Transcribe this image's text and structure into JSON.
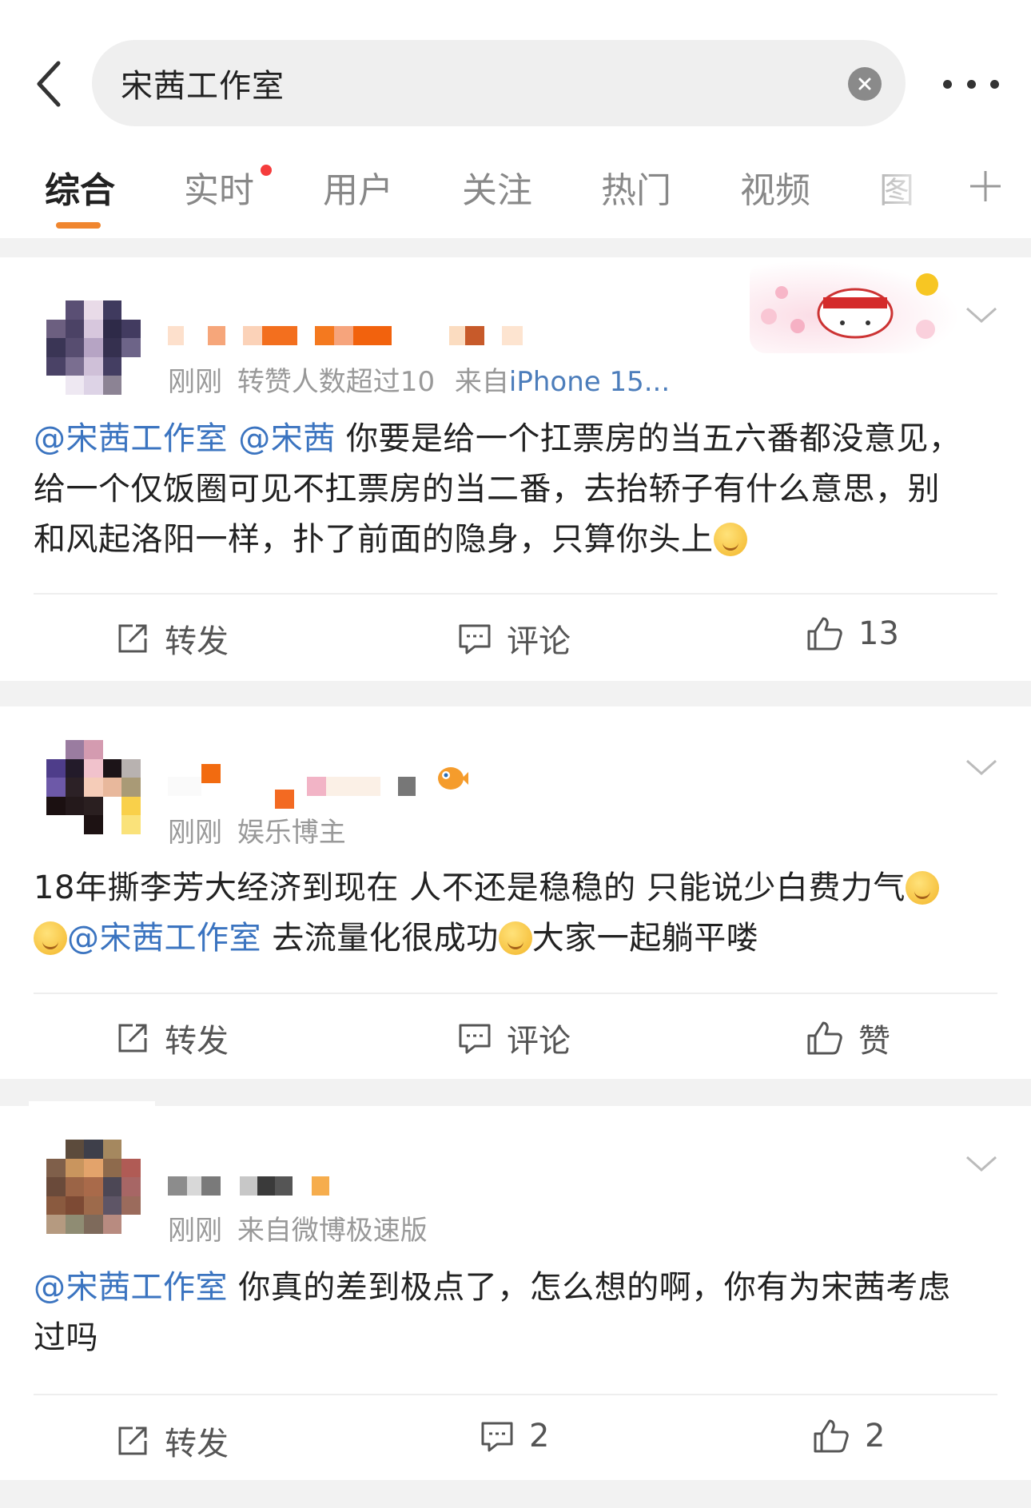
{
  "search": {
    "query": "宋茜工作室"
  },
  "tabs": [
    {
      "label": "综合",
      "active": true
    },
    {
      "label": "实时",
      "active": false,
      "has_dot": true
    },
    {
      "label": "用户",
      "active": false
    },
    {
      "label": "关注",
      "active": false
    },
    {
      "label": "热门",
      "active": false
    },
    {
      "label": "视频",
      "active": false
    },
    {
      "label": "图",
      "active": false
    }
  ],
  "colors": {
    "accent": "#f0862f",
    "link": "#3b74c0",
    "notification_dot": "#f53c3c"
  },
  "posts": [
    {
      "meta_time": "刚刚",
      "meta_extra": "转赞人数超过10",
      "meta_from": "来自",
      "meta_source": "iPhone 15...",
      "mention1": "@宋茜工作室",
      "mention2": "@宋茜",
      "text_line1": "你要是给一个扛票房的当五六番都没意见，",
      "text_line2": "给一个仅饭圈可见不扛票房的当二番，去抬轿子有什么意思，别",
      "text_line3": "和风起洛阳一样，扑了前面的隐身，只算你头上",
      "repost_label": "转发",
      "comment_label": "评论",
      "like_label": "13"
    },
    {
      "meta_time": "刚刚",
      "meta_extra": "娱乐博主",
      "text_line1": "18年撕李芳大经济到现在 人不还是稳稳的 只能说少白费力气",
      "mention1": "@宋茜工作室",
      "text_line2": "去流量化很成功",
      "text_line3": "大家一起躺平喽",
      "repost_label": "转发",
      "comment_label": "评论",
      "like_label": "赞"
    },
    {
      "meta_time": "刚刚",
      "meta_extra": "来自微博极速版",
      "mention1": "@宋茜工作室",
      "text_line1": "你真的差到极点了，怎么想的啊，你有为宋茜考虑",
      "text_line2": "过吗",
      "repost_label": "转发",
      "comment_label": "2",
      "like_label": "2"
    }
  ]
}
